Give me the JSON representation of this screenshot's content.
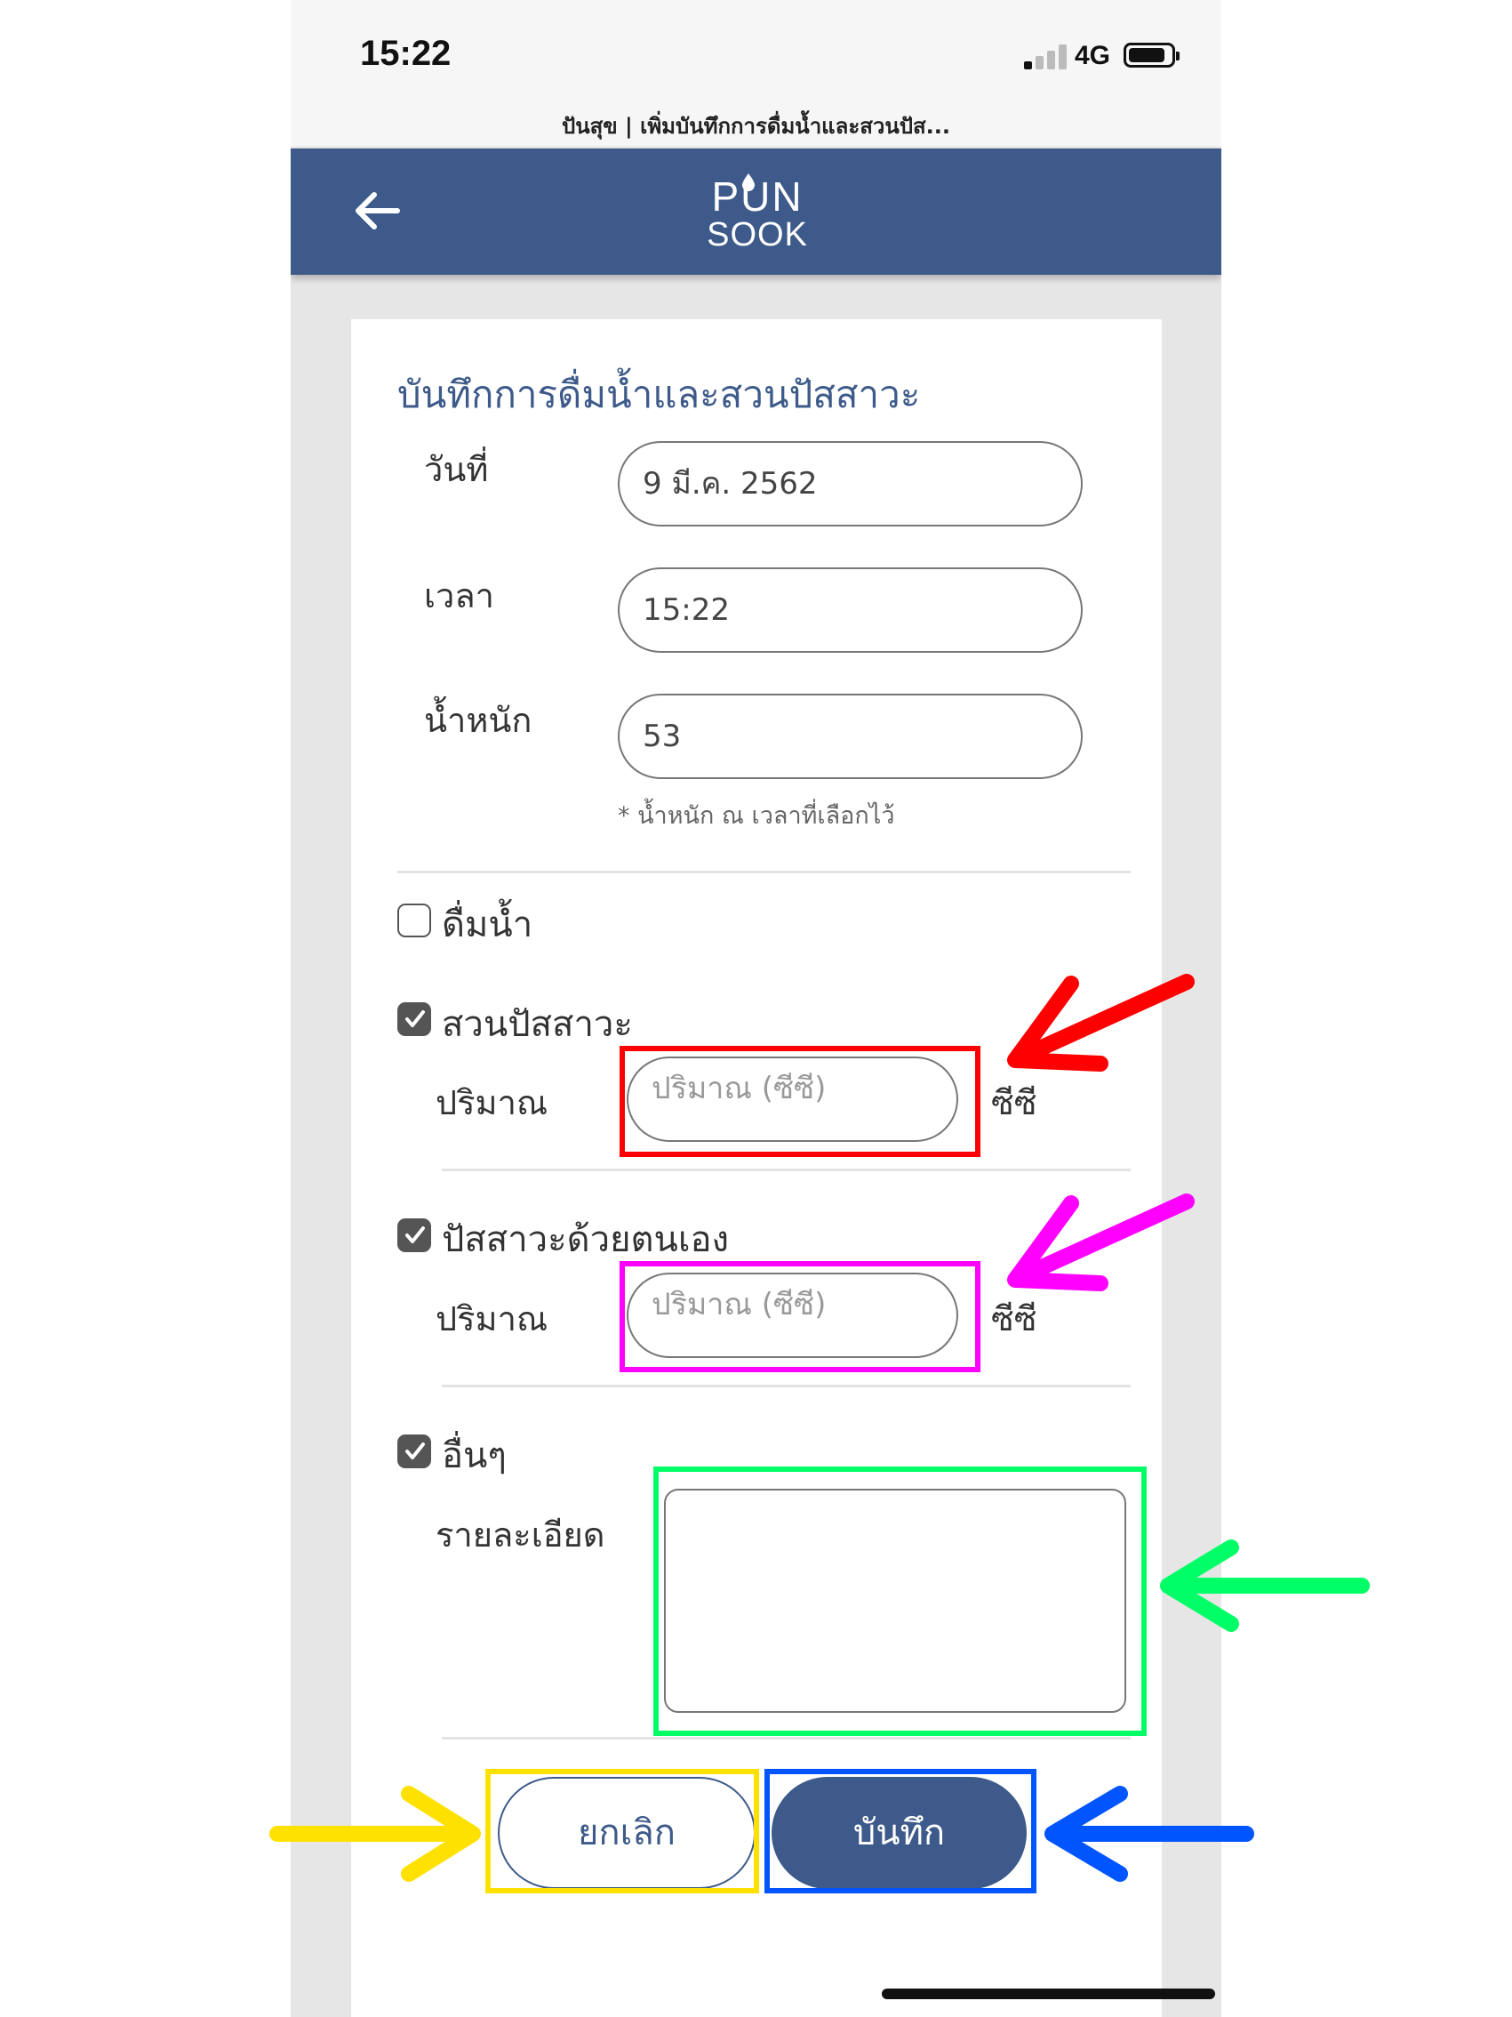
{
  "status_bar": {
    "time": "15:22",
    "network": "4G"
  },
  "browser": {
    "page_title": "ปันสุข | เพิ่มบันทึกการดื่มน้ำและสวนปัส..."
  },
  "app_bar": {
    "logo_line1": "PUN",
    "logo_line2": "SOOK",
    "brand_color": "#3d5a8a"
  },
  "form": {
    "heading": "บันทึกการดื่มน้ำและสวนปัสสาวะ",
    "date_label": "วันที่",
    "date_value": "9 มี.ค. 2562",
    "time_label": "เวลา",
    "time_value": "15:22",
    "weight_label": "น้ำหนัก",
    "weight_value": "53",
    "weight_note": "* น้ำหนัก ณ เวลาที่เลือกไว้",
    "drink": {
      "label": "ดื่มน้ำ",
      "checked": false
    },
    "catheter": {
      "label": "สวนปัสสาวะ",
      "checked": true,
      "amount_label": "ปริมาณ",
      "amount_placeholder": "ปริมาณ (ซีซี)",
      "unit": "ซีซี"
    },
    "self_urination": {
      "label": "ปัสสาวะด้วยตนเอง",
      "checked": true,
      "amount_label": "ปริมาณ",
      "amount_placeholder": "ปริมาณ (ซีซี)",
      "unit": "ซีซี"
    },
    "other": {
      "label": "อื่นๆ",
      "checked": true,
      "details_label": "รายละเอียด",
      "details_value": ""
    },
    "cancel_label": "ยกเลิก",
    "save_label": "บันทึก"
  },
  "annotations": {
    "red": "#ff0000",
    "magenta": "#ff00ff",
    "green": "#00ff66",
    "yellow": "#ffe100",
    "blue": "#0055ff"
  }
}
